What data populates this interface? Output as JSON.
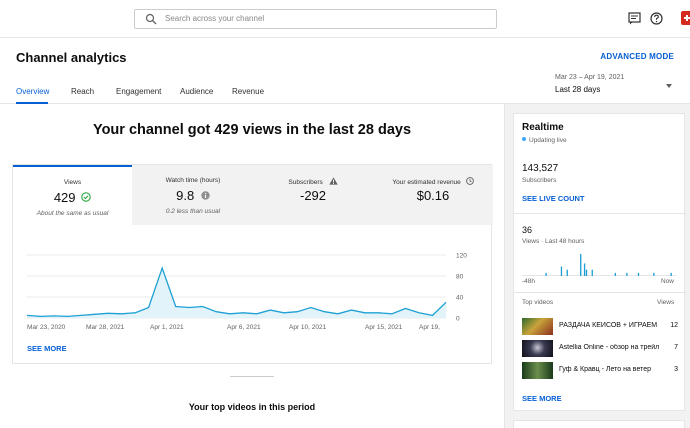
{
  "search": {
    "placeholder": "Search across your channel"
  },
  "header": {
    "title": "Channel analytics",
    "advanced_mode": "ADVANCED MODE",
    "tabs": [
      "Overview",
      "Reach",
      "Engagement",
      "Audience",
      "Revenue"
    ],
    "active_tab": "Overview",
    "date_range_dates": "Mar 23 – Apr 19, 2021",
    "date_range_label": "Last 28 days"
  },
  "main": {
    "headline": "Your channel got 429 views in the last 28 days",
    "metrics": [
      {
        "label": "Views",
        "value": "429",
        "sub": "About the same as usual",
        "icon": "check-circle-icon"
      },
      {
        "label": "Watch time (hours)",
        "value": "9.8",
        "sub": "0.2 less than usual",
        "icon": "info-icon"
      },
      {
        "label": "Subscribers",
        "value": "-292",
        "sub": "",
        "icon": "warning-icon"
      },
      {
        "label": "Your estimated revenue",
        "value": "$0.16",
        "sub": "",
        "icon": "info-icon"
      }
    ],
    "see_more": "SEE MORE",
    "top_videos_title": "Your top videos in this period"
  },
  "chart_data": {
    "type": "area",
    "x_ticks": [
      "Mar 23, 2020",
      "Mar 28, 2021",
      "Apr 1, 2021",
      "Apr 6, 2021",
      "Apr 10, 2021",
      "Apr 15, 2021",
      "Apr 19,"
    ],
    "y_ticks": [
      "120",
      "80",
      "40",
      "0"
    ],
    "ylim": [
      0,
      120
    ],
    "series": [
      {
        "values": [
          5,
          3,
          4,
          3,
          5,
          7,
          9,
          8,
          10,
          20,
          95,
          22,
          20,
          22,
          12,
          8,
          10,
          8,
          15,
          10,
          12,
          20,
          12,
          8,
          15,
          10,
          10,
          8,
          18,
          10,
          5,
          30
        ]
      }
    ],
    "colors": {
      "line": "#1ea0d5",
      "fill": "#e3f3fa"
    }
  },
  "realtime": {
    "title": "Realtime",
    "status": "Updating live",
    "subscribers_value": "143,527",
    "subscribers_label": "Subscribers",
    "see_live_count": "SEE LIVE COUNT",
    "views_value": "36",
    "views_label": "Views · Last 48 hours",
    "axis_start": "-48h",
    "axis_end": "Now",
    "bars": [
      0,
      0,
      0,
      0,
      0,
      0,
      0,
      0,
      0,
      0,
      0,
      0,
      1,
      0,
      0,
      0,
      0,
      0,
      0,
      0,
      3,
      0,
      0,
      2,
      0,
      0,
      0,
      0,
      0,
      0,
      7,
      0,
      4,
      2,
      0,
      0,
      2,
      0,
      0,
      0,
      0,
      0,
      0,
      0,
      0,
      0,
      0,
      0,
      1,
      0,
      0,
      0,
      0,
      0,
      1,
      0,
      0,
      0,
      0,
      0,
      1,
      0,
      0,
      0,
      0,
      0,
      0,
      0,
      1,
      0,
      0,
      0,
      0,
      0,
      0,
      0,
      0,
      1,
      0,
      0
    ],
    "top_videos_label": "Top videos",
    "views_col_label": "Views",
    "videos": [
      {
        "title": "РАЗДАЧА КЕЙСОВ + ИГРАЕМ С ВАМИ",
        "views": "12"
      },
      {
        "title": "Astellia Online - обзор на трейлер",
        "views": "7"
      },
      {
        "title": "Гуф & Кравц - Лето на ветер",
        "views": "3"
      }
    ],
    "see_more": "SEE MORE"
  },
  "colors": {
    "accent": "#065fd4",
    "chart_line": "#1ea0d5",
    "realtime_bar": "#1ea0d5"
  }
}
